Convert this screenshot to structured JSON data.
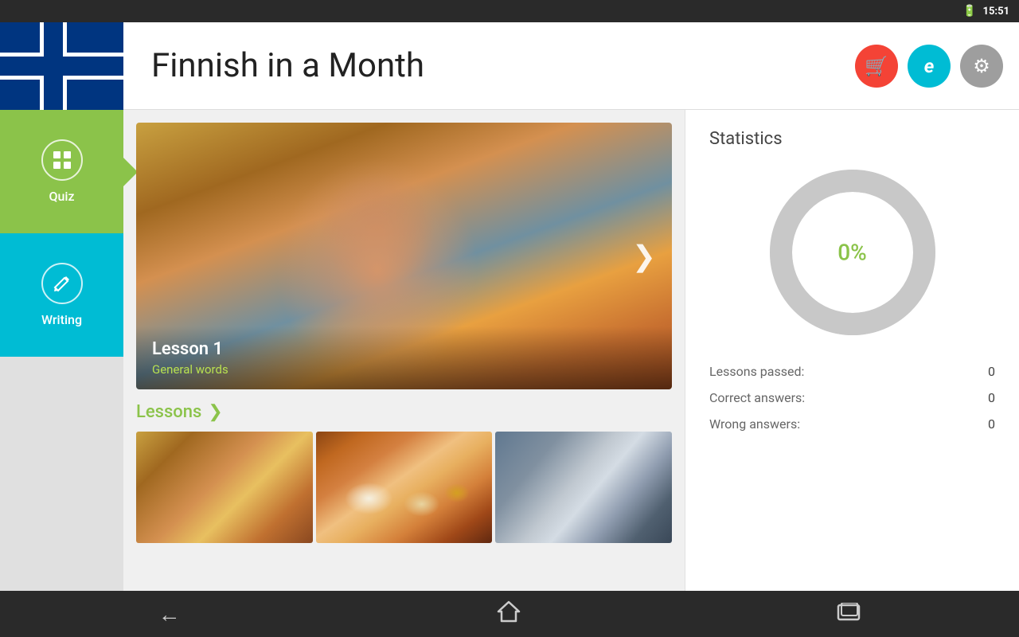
{
  "statusBar": {
    "time": "15:51",
    "batteryIcon": "🔋"
  },
  "header": {
    "title": "Finnish in a Month",
    "cartButtonLabel": "🛒",
    "infoButtonLabel": "e",
    "settingsButtonLabel": "⚙"
  },
  "sidebar": {
    "quizLabel": "Quiz",
    "writingLabel": "Writing",
    "quizIcon": "⊞",
    "writingIcon": "✎"
  },
  "featuredLesson": {
    "title": "Lesson 1",
    "subtitle": "General words",
    "arrowLabel": "❯"
  },
  "lessonsSection": {
    "title": "Lessons",
    "arrowLabel": "❯"
  },
  "statistics": {
    "title": "Statistics",
    "percent": "0%",
    "lessonsPassed": {
      "label": "Lessons passed:",
      "value": "0"
    },
    "correctAnswers": {
      "label": "Correct answers:",
      "value": "0"
    },
    "wrongAnswers": {
      "label": "Wrong answers:",
      "value": "0"
    }
  },
  "donut": {
    "trackColor": "#c8c8c8",
    "fillColor": "#8bc34a",
    "bgColor": "#e8e8e8",
    "radius": 90,
    "strokeWidth": 28,
    "percent": 0
  },
  "navigation": {
    "backIcon": "←",
    "homeIcon": "⌂",
    "recentsIcon": "▭"
  }
}
